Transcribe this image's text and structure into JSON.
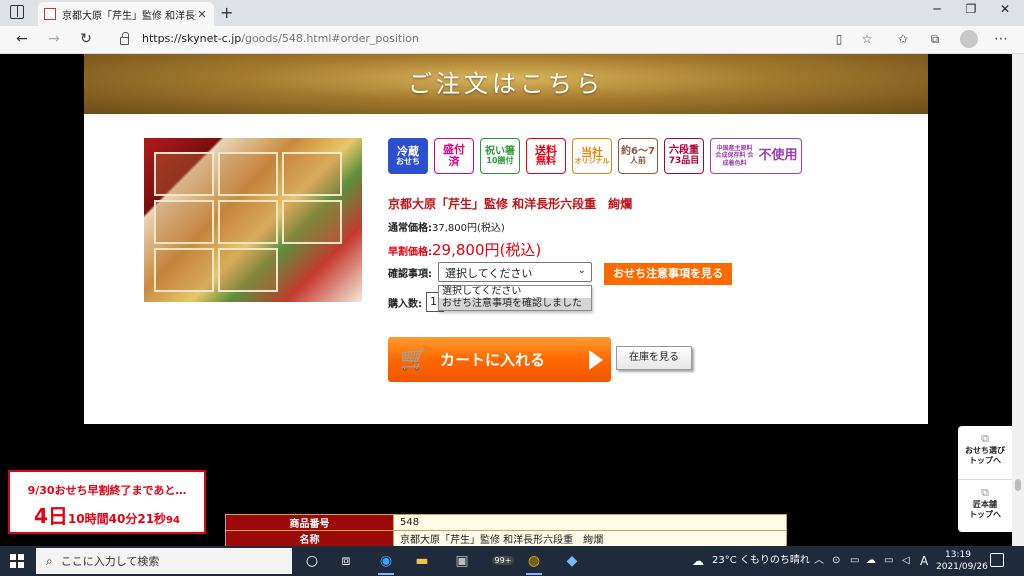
{
  "browser": {
    "tab_title": "京都大原「芹生」監修 和洋長形六段重",
    "url_host": "https://skynet-c.jp",
    "url_path": "/goods/548.html#order_position"
  },
  "banner": {
    "title": "ご注文はこちら"
  },
  "badges": [
    {
      "line1": "冷蔵",
      "line2": "おせち",
      "color": "#2b4fcf",
      "filled": true
    },
    {
      "line1": "盛付",
      "line2": "済",
      "color": "#e4007f",
      "filled": false
    },
    {
      "line1": "祝い箸",
      "line2": "10膳付",
      "color": "#2f9a3a",
      "filled": false
    },
    {
      "line1": "送料",
      "line2": "無料",
      "color": "#e60012",
      "filled": false
    },
    {
      "line1": "当社",
      "line2": "オリジナル",
      "color": "#f08300",
      "filled": false
    },
    {
      "line1": "約6〜7",
      "line2": "人前",
      "color": "#8a5a3c",
      "filled": false
    },
    {
      "line1": "六段重",
      "line2": "73品目",
      "color": "#b0003a",
      "filled": false
    },
    {
      "line1": "中国産主原料 合成保存料 合成着色料",
      "line2": "不使用",
      "color": "#9b3fb5",
      "filled": false
    }
  ],
  "product": {
    "name": "京都大原「芹生」監修 和洋長形六段重　絢爛",
    "regular_label": "通常価格:",
    "regular_price": "37,800円(税込)",
    "early_label": "早割価格:",
    "early_price": "29,800円(税込)"
  },
  "order": {
    "confirm_label": "確認事項:",
    "select_value": "選択してください",
    "options": [
      "選択してください",
      "おせち注意事項を確認しました"
    ],
    "notice_button": "おせち注意事項を見る",
    "qty_label": "購入数:",
    "qty_value": "1",
    "cart_button": "カートに入れる",
    "stock_button": "在庫を見る"
  },
  "side_menu": {
    "item1": "おせち選び\nトップへ",
    "item2": "匠本舗\nトップへ"
  },
  "countdown": {
    "line1": "9/30おせち早割終了まであと…",
    "days": "4日",
    "hours": "10時間",
    "minutes": "40分",
    "seconds": "21秒",
    "sub": "94"
  },
  "info_table": [
    {
      "header": "商品番号",
      "value": "548"
    },
    {
      "header": "名称",
      "value": "京都大原「芹生」監修 和洋長形六段重　絢爛"
    }
  ],
  "taskbar": {
    "search_placeholder": "ここに入力して検索",
    "badge_count": "99+",
    "weather": "23°C くもりのち晴れ",
    "ime": "A",
    "time": "13:19",
    "date": "2021/09/26"
  }
}
